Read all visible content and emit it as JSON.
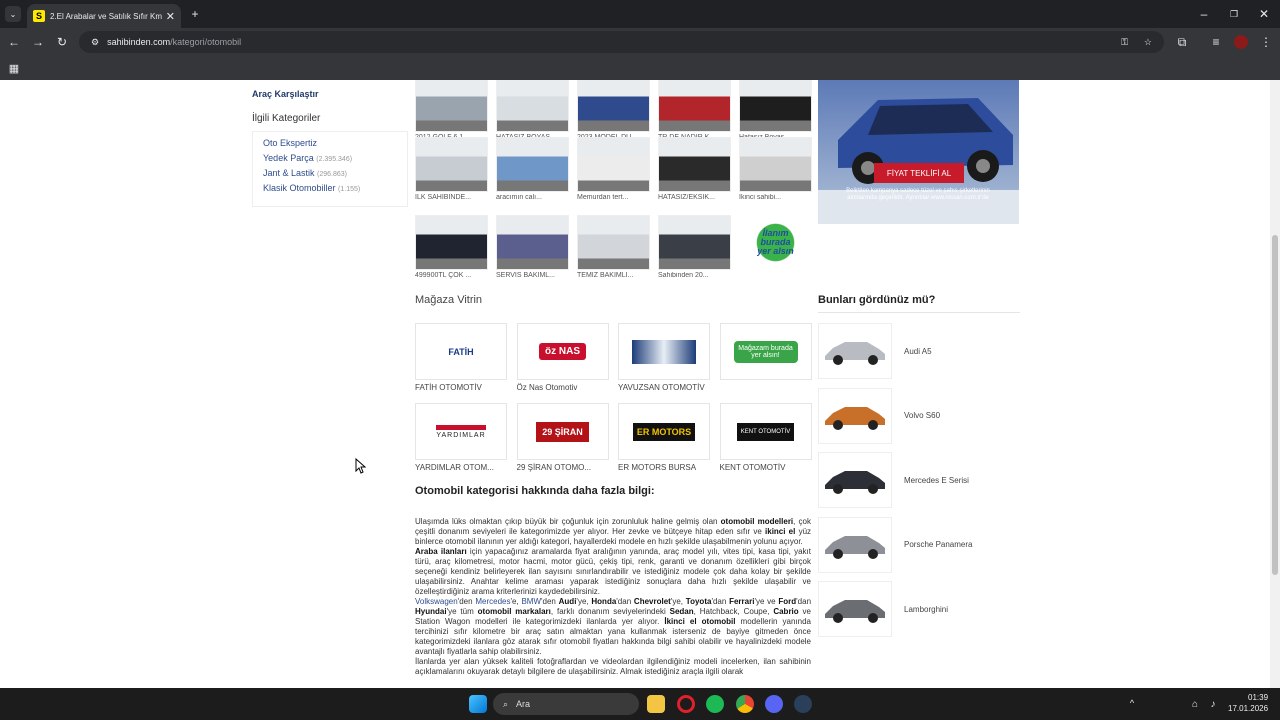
{
  "browser": {
    "tab_title": "2.El Arabalar ve Satılık Sıfır Km Oto",
    "url_domain": "sahibinden.com",
    "url_path": "/kategori/otomobil"
  },
  "sidebar": {
    "compare_link": "Araç Karşılaştır",
    "related_title": "İlgili Kategoriler",
    "related": [
      {
        "label": "Oto Ekspertiz",
        "count": ""
      },
      {
        "label": "Yedek Parça",
        "count": "(2.395.346)"
      },
      {
        "label": "Jant & Lastik",
        "count": "(296.863)"
      },
      {
        "label": "Klasik Otomobiller",
        "count": "(1.155)"
      }
    ]
  },
  "showcase": {
    "rows": [
      [
        "2012 GOLF 6 1...",
        "HATASIZ BOYAS...",
        "2023 MODEL DÜ...",
        "TR DE NADİR K...",
        "Hatasız Boyas..."
      ],
      [
        "İLK SAHİBİNDE...",
        "aracımın calı...",
        "Memurdan tert...",
        "HATASIZ/EKSİK...",
        "İkinci sahibi..."
      ],
      [
        "499900TL ÇOK ...",
        "SERVİS BAKIML...",
        "TEMİZ BAKIMLI...",
        "Sahibinden 20...",
        ""
      ]
    ],
    "promo_lines": [
      "İlanım",
      "burada",
      "yer alsın"
    ]
  },
  "banner": {
    "button": "FİYAT TEKLİFİ AL",
    "note": "Belirtilen kampanya sadece tüzel ve şahıs şirketlerinin alımlarında geçerlidir. Ayrıntılar www.nissan.com.tr'de"
  },
  "stores": {
    "title": "Mağaza Vitrin",
    "items": [
      {
        "name": "FATİH OTOMOTİV",
        "logo": "FATİH"
      },
      {
        "name": "Öz Nas Otomotiv",
        "logo": "öz NAS"
      },
      {
        "name": "YAVUZSAN OTOMOTİV",
        "logo": ""
      },
      {
        "name": "",
        "logo": "Mağazam burada yer alsın!"
      },
      {
        "name": "YARDIMLAR OTOM...",
        "logo": "YARDIMLAR"
      },
      {
        "name": "29 ŞİRAN OTOMO...",
        "logo": "29 ŞİRAN"
      },
      {
        "name": "ER MOTORS BURSA",
        "logo": "ER MOTORS"
      },
      {
        "name": "KENT OTOMOTİV",
        "logo": "KENT OTOMOTİV"
      }
    ]
  },
  "seen": {
    "title": "Bunları gördünüz mü?",
    "items": [
      "Audi A5",
      "Volvo S60",
      "Mercedes E Serisi",
      "Porsche Panamera",
      "Lamborghini"
    ],
    "colors": [
      "#b8bcc2",
      "#c8702a",
      "#2c2f35",
      "#8d9096",
      "#6a6e73"
    ]
  },
  "info": {
    "title": "Otomobil kategorisi hakkında daha fazla bilgi:"
  },
  "taskbar": {
    "search_placeholder": "Ara",
    "time": "01:39",
    "date": "17.01.2026"
  }
}
